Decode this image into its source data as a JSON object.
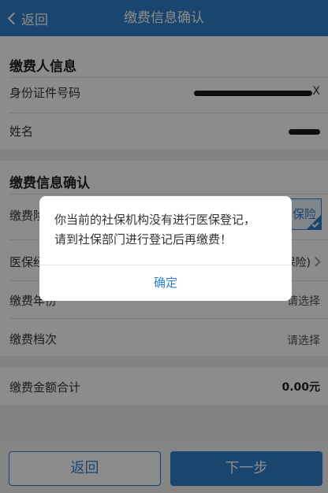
{
  "navbar": {
    "back_label": "返回",
    "title": "缴费信息确认"
  },
  "payer_section": {
    "title": "缴费人信息",
    "id_label": "身份证件号码",
    "id_suffix": "X",
    "name_label": "姓名"
  },
  "payment_section": {
    "title": "缴费信息确认",
    "insurance_label": "缴费险",
    "insurance_value": "保险",
    "medical_label": "医保经",
    "medical_value": "保险)",
    "year_label": "缴费年份",
    "year_value": "请选择",
    "level_label": "缴费档次",
    "level_value": "请选择"
  },
  "total": {
    "label": "缴费金额合计",
    "value": "0.00元"
  },
  "footer": {
    "back_label": "返回",
    "next_label": "下一步"
  },
  "dialog": {
    "line1": "你当前的社保机构没有进行医保登记，",
    "line2": "请到社保部门进行登记后再缴费！",
    "ok_label": "确定"
  },
  "colors": {
    "primary": "#2f7fca",
    "background": "#eeeeee"
  }
}
